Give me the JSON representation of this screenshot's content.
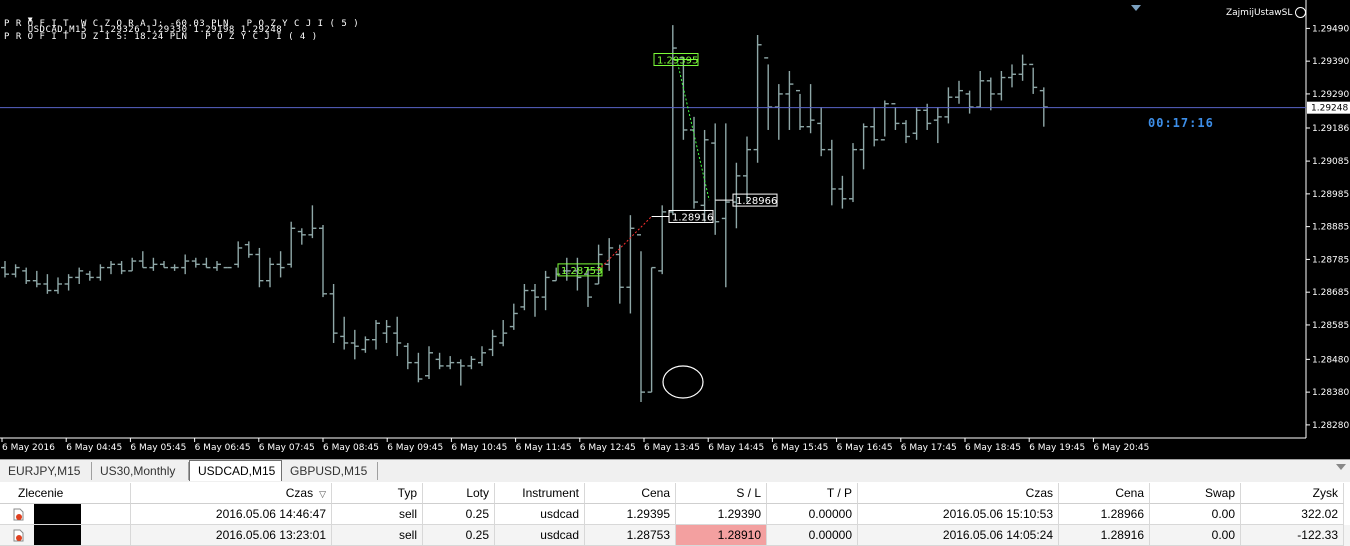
{
  "chart": {
    "symbol_line": "USDCAD,M15  1.29326 1.29330 1.29198 1.29248",
    "profit_yesterday": "P R O F I T  W C Z O R A J: -60.03 PLN   P O Z Y C J I ( 5 )",
    "profit_today": "P R O F I T  D Z I S: 18.24 PLN   P O Z Y C J I ( 4 )",
    "ea_name": "ZajmijUstawSL",
    "timer": "00:17:16",
    "current_price": "1.29248",
    "price_labels": [
      "1.29490",
      "1.29390",
      "1.29290",
      "1.29186",
      "1.29085",
      "1.28985",
      "1.28885",
      "1.28785",
      "1.28685",
      "1.28585",
      "1.28480",
      "1.28380",
      "1.28280"
    ],
    "time_labels": [
      "6 May 2016",
      "6 May 04:45",
      "6 May 05:45",
      "6 May 06:45",
      "6 May 07:45",
      "6 May 08:45",
      "6 May 09:45",
      "6 May 10:45",
      "6 May 11:45",
      "6 May 12:45",
      "6 May 13:45",
      "6 May 14:45",
      "6 May 15:45",
      "6 May 16:45",
      "6 May 17:45",
      "6 May 18:45",
      "6 May 19:45",
      "6 May 20:45"
    ],
    "trade_labels": [
      {
        "text": "1.29395",
        "kind": "buy"
      },
      {
        "text": "1.28916",
        "kind": "close"
      },
      {
        "text": "1.28966",
        "kind": "close"
      },
      {
        "text": "1.28753",
        "kind": "buy"
      }
    ],
    "bars": [
      [
        1.2878,
        1.2873,
        1.2876,
        1.2874
      ],
      [
        1.2877,
        1.2873,
        1.2874,
        1.2876
      ],
      [
        1.2876,
        1.2871,
        1.2875,
        1.2872
      ],
      [
        1.2875,
        1.287,
        1.2872,
        1.2871
      ],
      [
        1.2874,
        1.2868,
        1.2871,
        1.2869
      ],
      [
        1.2873,
        1.2868,
        1.2869,
        1.2871
      ],
      [
        1.2874,
        1.2869,
        1.2871,
        1.2873
      ],
      [
        1.2876,
        1.2871,
        1.2873,
        1.2875
      ],
      [
        1.2875,
        1.2872,
        1.2874,
        1.2873
      ],
      [
        1.2877,
        1.2872,
        1.2873,
        1.2876
      ],
      [
        1.2878,
        1.2874,
        1.2876,
        1.2877
      ],
      [
        1.2878,
        1.2874,
        1.2877,
        1.2875
      ],
      [
        1.2879,
        1.2875,
        1.2875,
        1.2878
      ],
      [
        1.2881,
        1.2876,
        1.2878,
        1.2876
      ],
      [
        1.2879,
        1.2875,
        1.2876,
        1.2877
      ],
      [
        1.2878,
        1.2876,
        1.2877,
        1.2876
      ],
      [
        1.2877,
        1.2875,
        1.2876,
        1.2876
      ],
      [
        1.288,
        1.2874,
        1.2876,
        1.2878
      ],
      [
        1.2879,
        1.2876,
        1.2878,
        1.2877
      ],
      [
        1.2879,
        1.2876,
        1.2877,
        1.2876
      ],
      [
        1.2878,
        1.2875,
        1.2876,
        1.2877
      ],
      [
        1.2876,
        1.2876,
        1.2876,
        1.2876
      ],
      [
        1.2884,
        1.2876,
        1.2877,
        1.2882
      ],
      [
        1.2884,
        1.2879,
        1.2883,
        1.288
      ],
      [
        1.2882,
        1.287,
        1.288,
        1.2872
      ],
      [
        1.2879,
        1.287,
        1.2872,
        1.2877
      ],
      [
        1.2881,
        1.2873,
        1.2877,
        1.2876
      ],
      [
        1.289,
        1.2876,
        1.2877,
        1.2888
      ],
      [
        1.2888,
        1.2883,
        1.2887,
        1.2886
      ],
      [
        1.2895,
        1.2885,
        1.2886,
        1.2888
      ],
      [
        1.2889,
        1.2867,
        1.2888,
        1.2868
      ],
      [
        1.2871,
        1.2853,
        1.2868,
        1.2856
      ],
      [
        1.2861,
        1.2851,
        1.2855,
        1.2853
      ],
      [
        1.2857,
        1.2848,
        1.2853,
        1.2852
      ],
      [
        1.2855,
        1.285,
        1.2851,
        1.2854
      ],
      [
        1.286,
        1.2851,
        1.2854,
        1.2859
      ],
      [
        1.286,
        1.2853,
        1.2856,
        1.2858
      ],
      [
        1.2861,
        1.2849,
        1.2856,
        1.2853
      ],
      [
        1.2853,
        1.2845,
        1.2852,
        1.2847
      ],
      [
        1.285,
        1.2841,
        1.2847,
        1.2842
      ],
      [
        1.2852,
        1.2842,
        1.2843,
        1.285
      ],
      [
        1.285,
        1.2845,
        1.2848,
        1.2846
      ],
      [
        1.2849,
        1.2845,
        1.2846,
        1.2847
      ],
      [
        1.2848,
        1.284,
        1.2847,
        1.2846
      ],
      [
        1.2849,
        1.2845,
        1.2846,
        1.2848
      ],
      [
        1.2852,
        1.2846,
        1.2847,
        1.285
      ],
      [
        1.2857,
        1.2849,
        1.2851,
        1.2855
      ],
      [
        1.286,
        1.2852,
        1.2853,
        1.2856
      ],
      [
        1.2865,
        1.2857,
        1.2858,
        1.2862
      ],
      [
        1.2871,
        1.2863,
        1.2864,
        1.2869
      ],
      [
        1.2871,
        1.2861,
        1.2869,
        1.2867
      ],
      [
        1.2875,
        1.2863,
        1.2867,
        1.2873
      ],
      [
        1.2876,
        1.2872,
        1.2872,
        1.2874
      ],
      [
        1.2879,
        1.2872,
        1.2875,
        1.2875
      ],
      [
        1.2879,
        1.2869,
        1.2875,
        1.2873
      ],
      [
        1.2876,
        1.2864,
        1.2874,
        1.2867
      ],
      [
        1.2883,
        1.2871,
        1.2871,
        1.288
      ],
      [
        1.2885,
        1.2875,
        1.2877,
        1.2882
      ],
      [
        1.2883,
        1.2865,
        1.288,
        1.287
      ],
      [
        1.2892,
        1.2862,
        1.287,
        1.2888
      ],
      [
        1.2881,
        1.2835,
        1.2886,
        1.2838
      ],
      [
        1.2876,
        1.2838,
        1.2838,
        1.2876
      ],
      [
        1.2895,
        1.2874,
        1.2875,
        1.2893
      ],
      [
        1.295,
        1.2892,
        1.2893,
        1.2943
      ],
      [
        1.294,
        1.2915,
        1.294,
        1.2918
      ],
      [
        1.2922,
        1.2894,
        1.2918,
        1.2896
      ],
      [
        1.2918,
        1.289,
        1.2895,
        1.2915
      ],
      [
        1.292,
        1.2886,
        1.2914,
        1.289
      ],
      [
        1.292,
        1.287,
        1.2891,
        1.2896
      ],
      [
        1.2908,
        1.2888,
        1.2896,
        1.2904
      ],
      [
        1.2916,
        1.2896,
        1.2904,
        1.2912
      ],
      [
        1.2947,
        1.2908,
        1.2912,
        1.2944
      ],
      [
        1.2938,
        1.2918,
        1.294,
        1.2925
      ],
      [
        1.2932,
        1.2915,
        1.2925,
        1.2929
      ],
      [
        1.2936,
        1.2918,
        1.2929,
        1.2932
      ],
      [
        1.2929,
        1.2918,
        1.293,
        1.2919
      ],
      [
        1.2932,
        1.2917,
        1.2919,
        1.2921
      ],
      [
        1.2925,
        1.291,
        1.292,
        1.2912
      ],
      [
        1.2915,
        1.2895,
        1.2912,
        1.29
      ],
      [
        1.2904,
        1.2894,
        1.29,
        1.2897
      ],
      [
        1.2914,
        1.2896,
        1.2897,
        1.2912
      ],
      [
        1.292,
        1.2906,
        1.2912,
        1.2919
      ],
      [
        1.2925,
        1.2913,
        1.2919,
        1.2915
      ],
      [
        1.2927,
        1.2916,
        1.2915,
        1.2926
      ],
      [
        1.2925,
        1.2918,
        1.2926,
        1.292
      ],
      [
        1.2921,
        1.2914,
        1.292,
        1.2916
      ],
      [
        1.2925,
        1.2915,
        1.2917,
        1.2924
      ],
      [
        1.2926,
        1.2918,
        1.2924,
        1.292
      ],
      [
        1.2925,
        1.2914,
        1.2921,
        1.2922
      ],
      [
        1.2931,
        1.292,
        1.2922,
        1.2928
      ],
      [
        1.2933,
        1.2926,
        1.2928,
        1.293
      ],
      [
        1.293,
        1.2923,
        1.2929,
        1.2925
      ],
      [
        1.2936,
        1.2925,
        1.2925,
        1.2933
      ],
      [
        1.2934,
        1.2924,
        1.2933,
        1.2929
      ],
      [
        1.2936,
        1.2927,
        1.2929,
        1.2934
      ],
      [
        1.2938,
        1.2931,
        1.2934,
        1.2935
      ],
      [
        1.2941,
        1.2933,
        1.2935,
        1.2938
      ],
      [
        1.2937,
        1.2929,
        1.2938,
        1.2931
      ],
      [
        1.2931,
        1.2919,
        1.293,
        1.2925
      ]
    ]
  },
  "tabs": [
    {
      "label": "EURJPY,M15",
      "active": false
    },
    {
      "label": "US30,Monthly",
      "active": false
    },
    {
      "label": "USDCAD,M15",
      "active": true
    },
    {
      "label": "GBPUSD,M15",
      "active": false
    }
  ],
  "table": {
    "headers": [
      "Zlecenie",
      "Czas",
      "Typ",
      "Loty",
      "Instrument",
      "Cena",
      "S / L",
      "T / P",
      "Czas",
      "Cena",
      "Swap",
      "Zysk"
    ],
    "rows": [
      [
        "",
        "2016.05.06 14:46:47",
        "sell",
        "0.25",
        "usdcad",
        "1.29395",
        "1.29390",
        "0.00000",
        "2016.05.06 15:10:53",
        "1.28966",
        "0.00",
        "322.02"
      ],
      [
        "",
        "2016.05.06 13:23:01",
        "sell",
        "0.25",
        "usdcad",
        "1.28753",
        "1.28910",
        "0.00000",
        "2016.05.06 14:05:24",
        "1.28916",
        "0.00",
        "-122.33"
      ]
    ]
  }
}
